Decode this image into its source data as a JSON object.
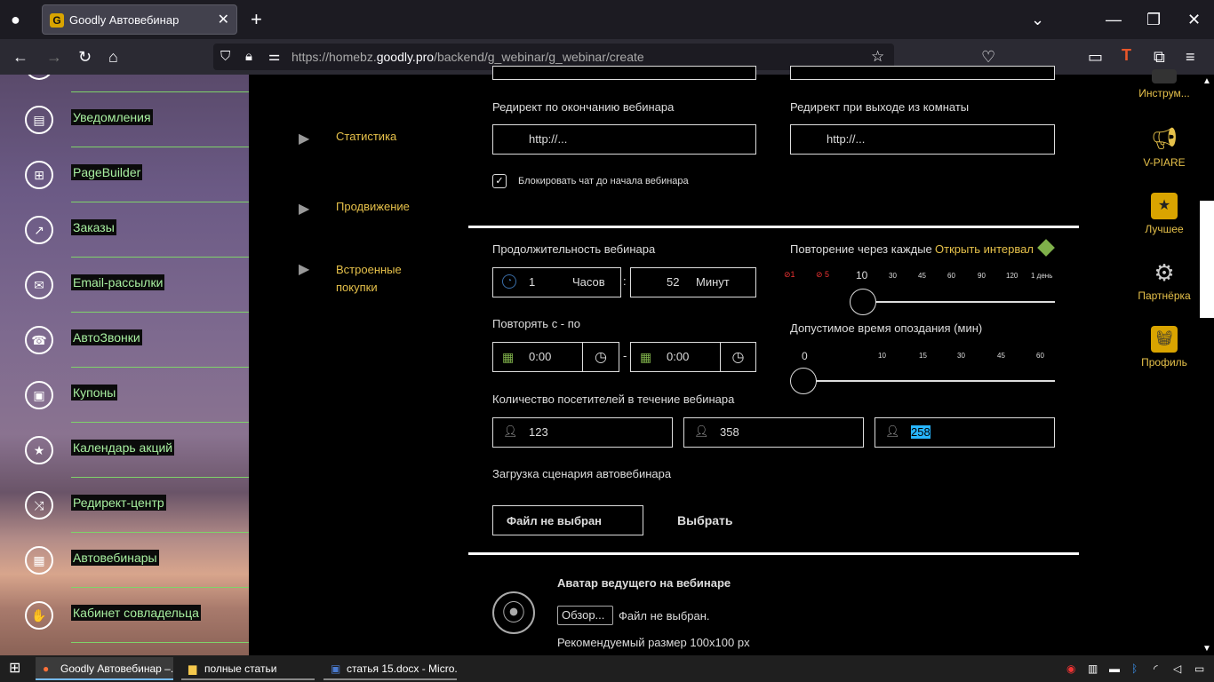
{
  "browser": {
    "tab_title": "Goodly Автовебинар",
    "url_prefix": "https://homebz.",
    "url_domain": "goodly.pro",
    "url_path": "/backend/g_webinar/g_webinar/create"
  },
  "sidebar": {
    "items": [
      {
        "label": "Уведомления",
        "icon": "notifications-icon"
      },
      {
        "label": "PageBuilder",
        "icon": "pagebuilder-icon"
      },
      {
        "label": "Заказы",
        "icon": "orders-icon"
      },
      {
        "label": "Email-рассылки",
        "icon": "email-icon"
      },
      {
        "label": "АвтоЗвонки",
        "icon": "phone-icon"
      },
      {
        "label": "Купоны",
        "icon": "coupon-icon"
      },
      {
        "label": "Календарь акций",
        "icon": "calendar-icon"
      },
      {
        "label": "Редирект-центр",
        "icon": "redirect-icon"
      },
      {
        "label": "Автовебинары",
        "icon": "webinar-icon"
      },
      {
        "label": "Кабинет совладельца",
        "icon": "handshake-icon"
      }
    ]
  },
  "left_menu": {
    "stats": "Статистика",
    "promo": "Продвижение",
    "purchases": "Встроенные покупки"
  },
  "form": {
    "redirect_end_label": "Редирект по окончанию вебинара",
    "redirect_end_value": "http://...",
    "redirect_exit_label": "Редирект при выходе из комнаты",
    "redirect_exit_value": "http://...",
    "block_chat_label": "Блокировать чат до начала вебинара",
    "block_chat_checked": true,
    "duration_label": "Продолжительность вебинара",
    "duration_hours": "1",
    "hours_unit": "Часов",
    "duration_minutes": "52",
    "minutes_unit": "Минут",
    "repeat_label": "Повторение через каждые",
    "open_interval": "Открыть интервал",
    "repeat_ticks": [
      "1",
      "5",
      "10",
      "30",
      "45",
      "60",
      "90",
      "120",
      "1 день"
    ],
    "repeat_from_to_label": "Повторять с - по",
    "time_from": "0:00",
    "time_to": "0:00",
    "late_label": "Допустимое время опоздания (мин)",
    "late_ticks": [
      "0",
      "10",
      "15",
      "30",
      "45",
      "60"
    ],
    "visitors_label": "Количество посетителей в течение вебинара",
    "visitors": [
      "123",
      "358",
      "258"
    ],
    "scenario_label": "Загрузка сценария автовебинара",
    "file_none": "Файл не выбран",
    "choose": "Выбрать",
    "avatar_label": "Аватар ведущего на вебинаре",
    "browse": "Обзор...",
    "file_none_dot": "Файл не выбран.",
    "recommended": "Рекомендуемый размер 100x100 px"
  },
  "right_panel": [
    {
      "label": "Инструм..."
    },
    {
      "label": "V-PIARE"
    },
    {
      "label": "Лучшее"
    },
    {
      "label": "Партнёрка"
    },
    {
      "label": "Профиль"
    }
  ],
  "taskbar": {
    "items": [
      "Goodly Автовебинар –...",
      "полные статьи",
      "статья 15.docx - Micro..."
    ]
  },
  "colors": {
    "accent": "#e6c14a",
    "sidebar_text": "#a8f0a0",
    "selected": "#27b5ff"
  }
}
